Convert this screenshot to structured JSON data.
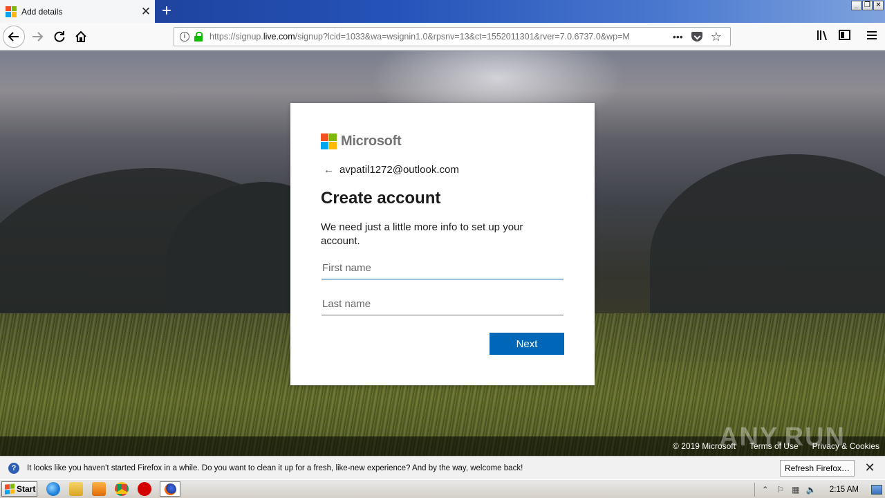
{
  "browser": {
    "tab_title": "Add details",
    "tab_close_glyph": "✕",
    "new_tab_glyph": "+",
    "url_scheme_path_pre": "https://signup.",
    "url_host": "live.com",
    "url_rest": "/signup?lcid=1033&wa=wsignin1.0&rpsnv=13&ct=1552011301&rver=7.0.6737.0&wp=M",
    "page_actions_glyph": "•••",
    "icons": [
      "back-arrow-icon",
      "forward-arrow-icon",
      "reload-icon",
      "home-icon",
      "info-icon",
      "lock-icon",
      "pocket-icon",
      "bookmark-star-icon",
      "library-icon",
      "sidebar-icon",
      "menu-icon"
    ]
  },
  "signup": {
    "brand": "Microsoft",
    "brand_colors": [
      "#f25022",
      "#7fba00",
      "#00a4ef",
      "#ffb900"
    ],
    "email": "avpatil1272@outlook.com",
    "title": "Create account",
    "description": "We need just a little more info to set up your account.",
    "first_name_placeholder": "First name",
    "last_name_placeholder": "Last name",
    "first_name_value": "",
    "last_name_value": "",
    "next_label": "Next",
    "accent_color": "#0067b8"
  },
  "page_footer": {
    "copyright": "© 2019 Microsoft",
    "terms": "Terms of Use",
    "privacy": "Privacy & Cookies"
  },
  "watermark": "ANY.RUN",
  "notification": {
    "message": "It looks like you haven't started Firefox in a while. Do you want to clean it up for a fresh, like-new experience? And by the way, welcome back!",
    "button_label": "Refresh Firefox…"
  },
  "taskbar": {
    "start_label": "Start",
    "clock": "2:15 AM"
  }
}
